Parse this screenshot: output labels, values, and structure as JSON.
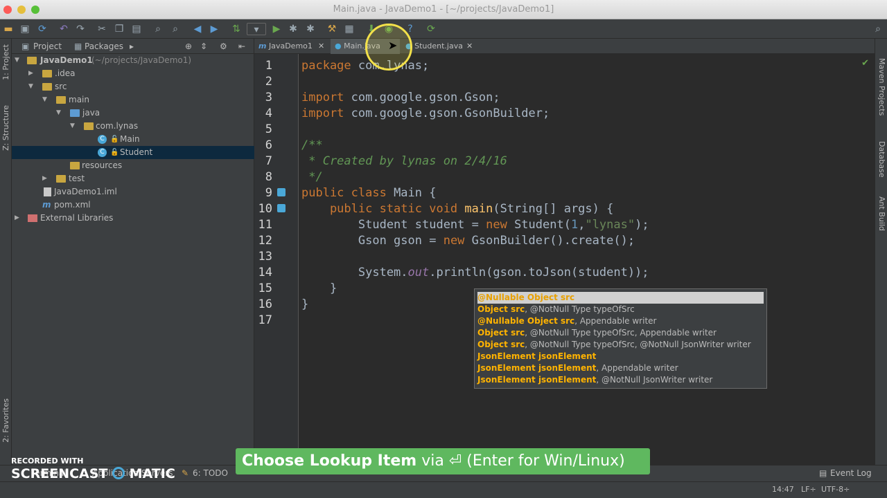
{
  "window": {
    "title": "Main.java - JavaDemo1 - [~/projects/JavaDemo1]"
  },
  "colors": {
    "accent": "#5fb85f",
    "selection": "#0d293e",
    "keyword": "#cc7832",
    "comment": "#629755"
  },
  "toolbar": {
    "icons": [
      "folder-open-icon",
      "save-icon",
      "sync-icon",
      "undo-icon",
      "redo-icon",
      "cut-icon",
      "copy-icon",
      "paste-icon",
      "find-icon",
      "replace-icon",
      "back-icon",
      "forward-icon",
      "build-icon",
      "run-config-dropdown-icon",
      "run-icon",
      "debug-icon",
      "coverage-icon",
      "tools-icon",
      "project-structure-icon",
      "sdk-manager-icon",
      "android-icon",
      "help-icon",
      "sync-gradle-icon",
      "search-everywhere-icon"
    ]
  },
  "left_strip": {
    "project_tab": "1: Project",
    "structure_tab": "Z: Structure",
    "favorites_tab": "2: Favorites"
  },
  "right_strip": {
    "maven_tab": "Maven Projects",
    "database_tab": "Database",
    "ant_tab": "Ant Build"
  },
  "project_panel": {
    "tab_project": "Project",
    "tab_packages": "Packages",
    "tree": [
      {
        "label": "JavaDemo1",
        "suffix": "(~/projects/JavaDemo1)"
      },
      {
        "label": ".idea"
      },
      {
        "label": "src"
      },
      {
        "label": "main"
      },
      {
        "label": "java"
      },
      {
        "label": "com.lynas"
      },
      {
        "label": "Main"
      },
      {
        "label": "Student"
      },
      {
        "label": "resources"
      },
      {
        "label": "test"
      },
      {
        "label": "JavaDemo1.iml"
      },
      {
        "label": "pom.xml"
      },
      {
        "label": "External Libraries"
      }
    ]
  },
  "editor_tabs": [
    {
      "label": "JavaDemo1"
    },
    {
      "label": "Main.java"
    },
    {
      "label": "Student.java"
    }
  ],
  "editor": {
    "line_numbers": [
      "1",
      "2",
      "3",
      "4",
      "5",
      "6",
      "7",
      "8",
      "9",
      "10",
      "11",
      "12",
      "13",
      "14",
      "15",
      "16",
      "17"
    ],
    "tokens": {
      "l1_kw": "package",
      "l1_rest": " com.lynas;",
      "l3_kw": "import",
      "l3_rest": " com.google.gson.Gson;",
      "l4_kw": "import",
      "l4_rest": " com.google.gson.GsonBuilder;",
      "l6": "/**",
      "l7": " * Created by lynas on 2/4/16",
      "l8": " */",
      "l9_kw": "public class",
      "l9_rest": " Main {",
      "l10_kw": "    public static void",
      "l10_fn": " main",
      "l10_rest": "(String[] args) {",
      "l11_a": "        Student student = ",
      "l11_kw": "new",
      "l11_b": " Student(",
      "l11_num": "1",
      "l11_c": ",",
      "l11_str": "\"lynas\"",
      "l11_d": ");",
      "l12_a": "        Gson gson = ",
      "l12_kw": "new",
      "l12_b": " GsonBuilder().create();",
      "l14_a": "        System.",
      "l14_fld": "out",
      "l14_b": ".println(gson.toJson(student));",
      "l15": "    }",
      "l16": "}"
    }
  },
  "completion_popup": {
    "items": [
      {
        "bold": "@Nullable Object src",
        "rest": ""
      },
      {
        "bold": "Object src",
        "rest": ", @NotNull Type typeOfSrc"
      },
      {
        "bold": "@Nullable Object src",
        "rest": ", Appendable writer"
      },
      {
        "bold": "Object src",
        "rest": ", @NotNull Type typeOfSrc, Appendable writer"
      },
      {
        "bold": "Object src",
        "rest": ", @NotNull Type typeOfSrc, @NotNull JsonWriter writer"
      },
      {
        "bold": "JsonElement jsonElement",
        "rest": ""
      },
      {
        "bold": "JsonElement jsonElement",
        "rest": ", Appendable writer"
      },
      {
        "bold": "JsonElement jsonElement",
        "rest": ", @NotNull JsonWriter writer"
      }
    ]
  },
  "hint_banner": {
    "bold": "Choose Lookup Item",
    "thin": " via ⏎ (Enter for Win/Linux)"
  },
  "bottom_tabs": {
    "terminal": "Terminal",
    "app_servers": "Application Servers",
    "todo": "6: TODO",
    "event_log": "Event Log"
  },
  "status": {
    "position": "14:47",
    "line_sep": "LF÷",
    "encoding": "UTF-8÷"
  },
  "watermark": {
    "line1": "RECORDED WITH",
    "line2a": "SCREENCAST",
    "line2b": "MATIC"
  }
}
